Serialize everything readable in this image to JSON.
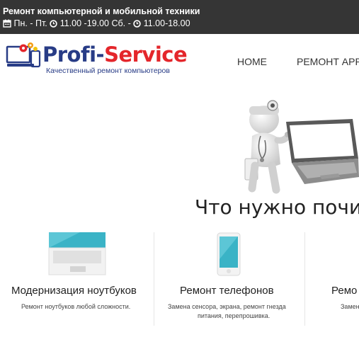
{
  "topbar": {
    "line1": "Ремонт компьютерной и мобильной техники",
    "schedule_weekdays": "Пн. - Пт.",
    "hours_weekdays": "11.00 -19.00 Сб. -",
    "hours_saturday": "11.00-18.00"
  },
  "logo": {
    "brand_part1": "Profi-",
    "brand_part2": "Service",
    "slogan": "Качественный ремонт компьютеров"
  },
  "nav": {
    "home": "HOME",
    "apple": "РЕМОНТ APPL"
  },
  "hero": {
    "title": "Что нужно почин"
  },
  "services": [
    {
      "title": "Модернизация ноутбуков",
      "text1": "Ремонт ноутбуков любой сложности.",
      "text2": ""
    },
    {
      "title": "Ремонт телефонов",
      "text1": "Замена сенсора, экрана, ремонт гнезда",
      "text2": "питания, перепрошивка."
    },
    {
      "title": "Ремо",
      "text1": "Замен",
      "text2": ""
    }
  ],
  "colors": {
    "topbar": "#353535",
    "brand_blue": "#283c86",
    "brand_red": "#e4262b",
    "accent_teal": "#3ab3c6"
  }
}
